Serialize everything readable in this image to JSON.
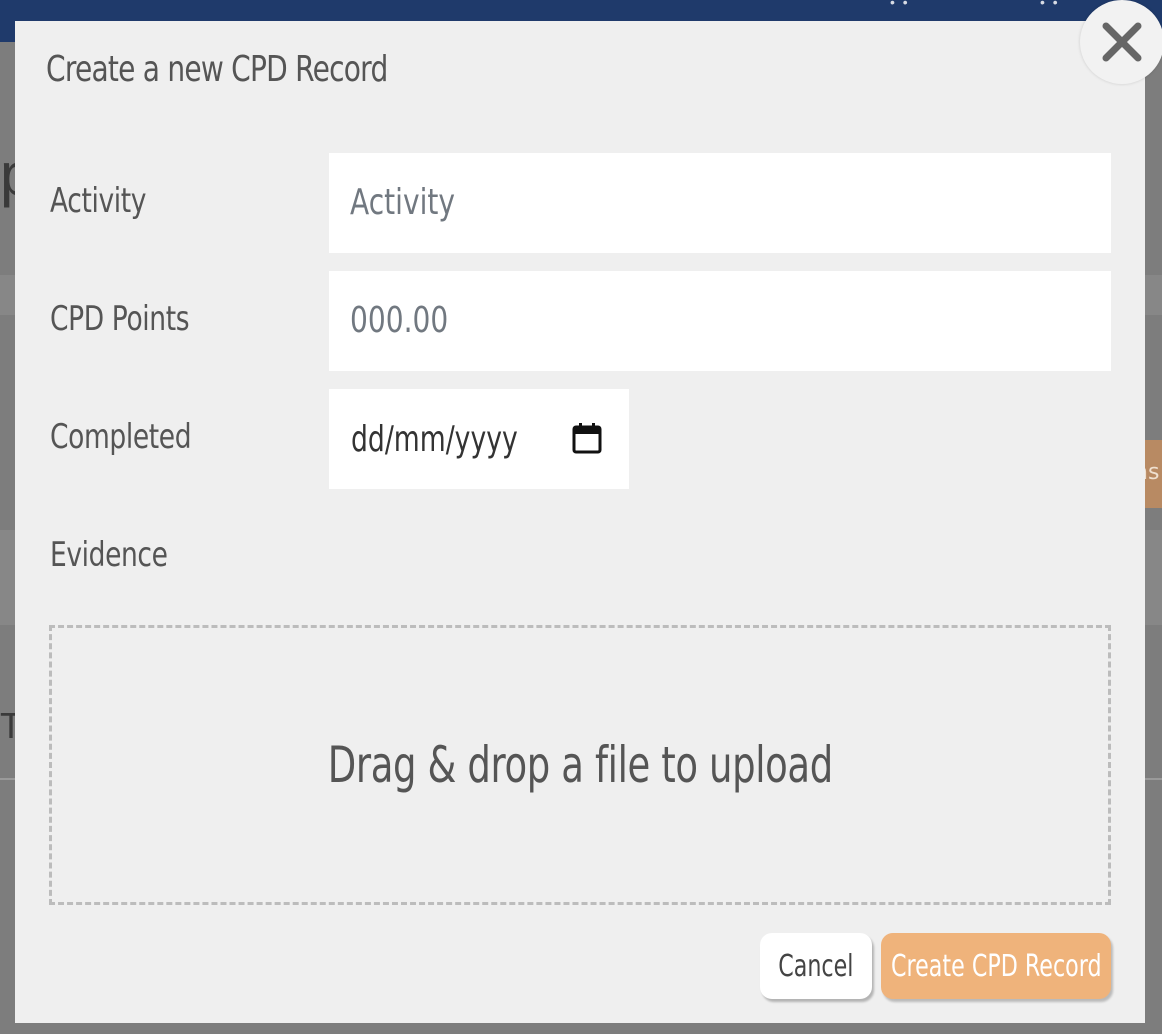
{
  "modal": {
    "title": "Create a new CPD Record",
    "close_icon": "close-icon"
  },
  "form": {
    "activity": {
      "label": "Activity",
      "placeholder": "Activity"
    },
    "cpd_points": {
      "label": "CPD Points",
      "placeholder": "000.00"
    },
    "completed": {
      "label": "Completed",
      "placeholder": "dd/mm/yyyy",
      "icon": "calendar-icon"
    },
    "evidence": {
      "label": "Evidence",
      "dropzone_text": "Drag & drop a file to upload"
    }
  },
  "actions": {
    "cancel_label": "Cancel",
    "create_label": "Create CPD Record"
  },
  "background": {
    "partial_letters": [
      "p",
      "Ty",
      "ns"
    ]
  },
  "colors": {
    "topbar": "#1f3a6b",
    "modal_bg": "#efefef",
    "primary_button": "#efb37b",
    "overlay": "#7d7d7d"
  }
}
